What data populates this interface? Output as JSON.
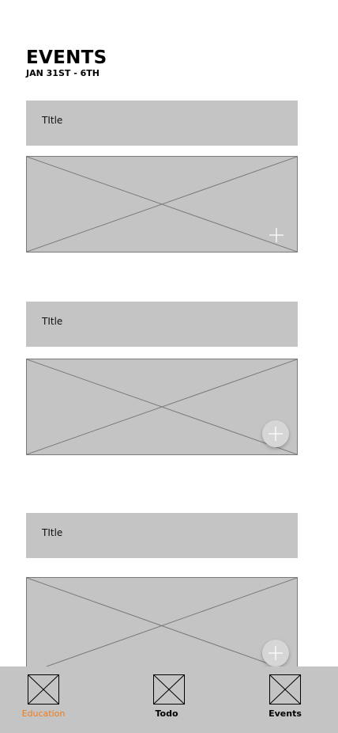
{
  "header": {
    "title": "EVENTS",
    "subtitle": "JAN 31ST - 6TH"
  },
  "events": [
    {
      "title": "TItle",
      "action_icon": "plus-icon"
    },
    {
      "title": "TItle",
      "action_icon": "plus-icon"
    },
    {
      "title": "TItle",
      "action_icon": "plus-icon"
    }
  ],
  "nav": {
    "items": [
      {
        "label": "Education",
        "icon": "image-placeholder-icon",
        "active": true
      },
      {
        "label": "Todo",
        "icon": "image-placeholder-icon",
        "active": false
      },
      {
        "label": "Events",
        "icon": "image-placeholder-icon",
        "active": false
      }
    ]
  },
  "colors": {
    "active": "#f07a1a",
    "placeholder": "#c4c4c4",
    "text": "#000000"
  }
}
